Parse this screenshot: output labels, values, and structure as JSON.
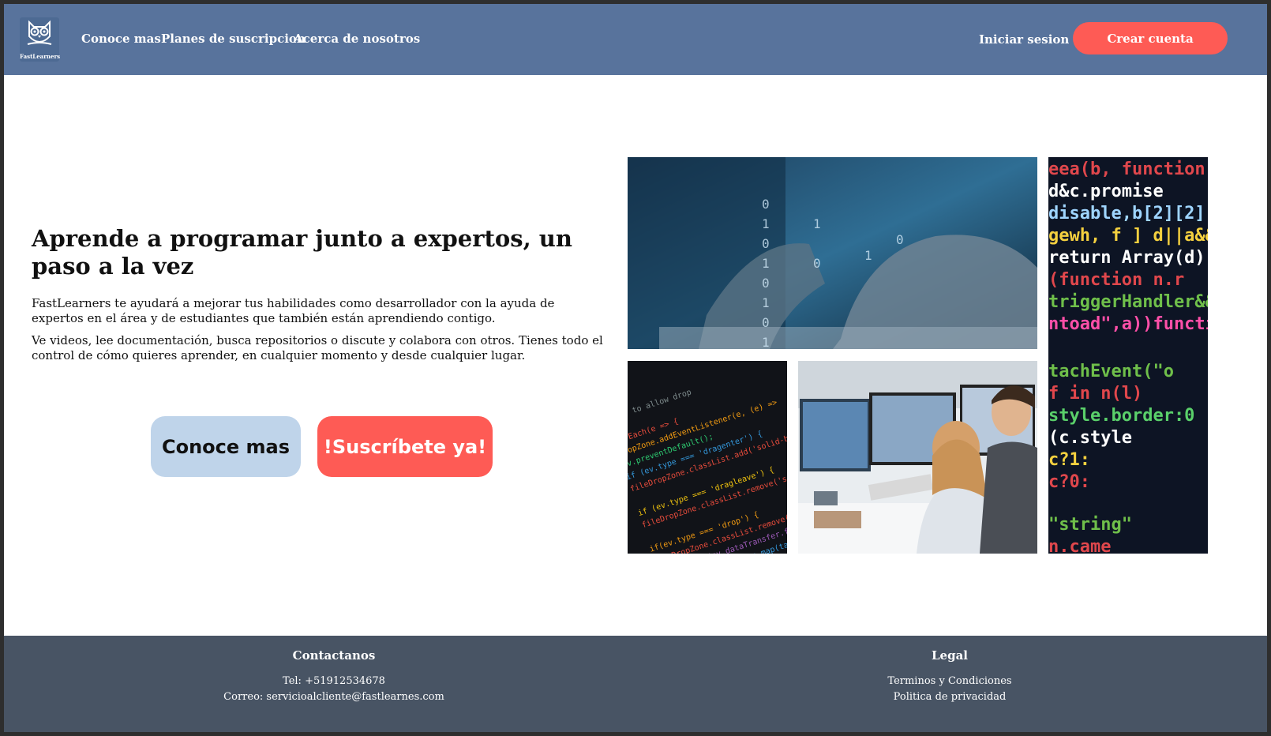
{
  "brand": {
    "name": "FastLearners",
    "logo_icon": "owl-icon"
  },
  "nav": {
    "links": [
      "Conoce mas",
      "Planes de suscripcion",
      "Acerca de nosotros"
    ],
    "login_label": "Iniciar sesion",
    "signup_label": "Crear cuenta"
  },
  "hero": {
    "title": "Aprende a programar junto a expertos, un paso a la vez",
    "paragraph1": "FastLearners te ayudará a mejorar tus habilidades como desarrollador con la ayuda de expertos en el área y de estudiantes que también están aprendiendo contigo.",
    "paragraph2": "Ve videos, lee documentación, busca repositorios o discute y colabora con otros. Tienes todo el control de cómo quieres aprender, en cualquier momento y desde cualquier lugar.",
    "button_learn": "Conoce mas",
    "button_subscribe": "!Suscríbete ya!"
  },
  "gallery": {
    "images": [
      "typing-hands-binary-image",
      "code-editor-image",
      "students-at-computer-image",
      "colorful-code-image"
    ]
  },
  "footer": {
    "contact": {
      "heading": "Contactanos",
      "phone": "Tel: +51912534678",
      "email": "Correo: servicioalcliente@fastlearnes.com"
    },
    "legal": {
      "heading": "Legal",
      "terms": "Terminos y Condiciones",
      "privacy": "Politica de privacidad"
    }
  },
  "colors": {
    "navbar": "#58739c",
    "accent": "#fe5b55",
    "secondary_button": "#bfd4ea",
    "footer": "#485464"
  }
}
